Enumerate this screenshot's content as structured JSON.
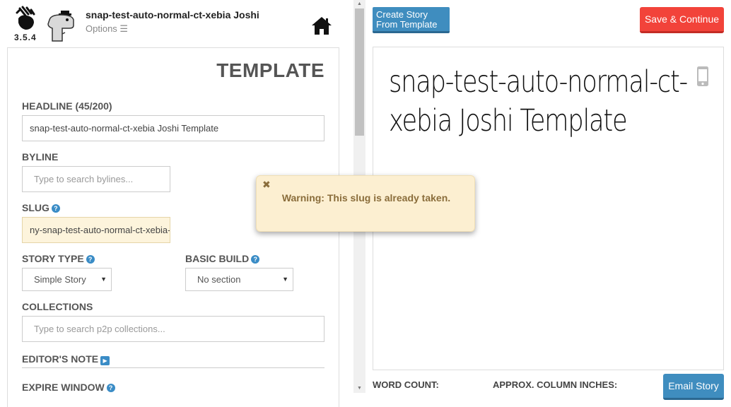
{
  "app": {
    "version": "3.5.4",
    "document_title": "snap-test-auto-normal-ct-xebia Joshi",
    "options_label": "Options ☰"
  },
  "form": {
    "panel_title": "TEMPLATE",
    "headline_label": "HEADLINE (45/200)",
    "headline_value": "snap-test-auto-normal-ct-xebia Joshi Template",
    "byline_label": "BYLINE",
    "byline_placeholder": "Type to search bylines...",
    "slug_label": "SLUG",
    "slug_value": "ny-snap-test-auto-normal-ct-xebia-joshi-template",
    "story_type_label": "STORY TYPE",
    "story_type_value": "Simple Story",
    "basic_build_label": "BASIC BUILD",
    "basic_build_value": "No section",
    "collections_label": "COLLECTIONS",
    "collections_placeholder": "Type to search p2p collections...",
    "editors_note_label": "EDITOR'S NOTE",
    "expire_window_label": "EXPIRE WINDOW",
    "help_glyph": "?",
    "play_glyph": "▶",
    "caret_glyph": "▼"
  },
  "toolbar": {
    "create_story_label": "Create Story From Template",
    "save_continue_label": "Save & Continue",
    "email_story_label": "Email Story"
  },
  "preview": {
    "headline": "snap-test-auto-normal-ct-xebia Joshi Template",
    "word_count_label": "WORD COUNT:",
    "column_inches_label": "APPROX. COLUMN INCHES:"
  },
  "warning": {
    "close_glyph": "✖",
    "message": "Warning: This slug is already taken."
  },
  "icons": {
    "logo": "hand-logo-icon",
    "mascot": "dinosaur-mascot-icon",
    "home": "home-icon",
    "phone": "mobile-phone-icon"
  },
  "colors": {
    "primary_button": "#3f8dbf",
    "danger_button": "#f2433a",
    "warning_bg": "#fcefd1",
    "warning_text": "#8a6d3b",
    "slug_field_bg": "#fdf4dc",
    "help_icon": "#3a8cc6"
  }
}
